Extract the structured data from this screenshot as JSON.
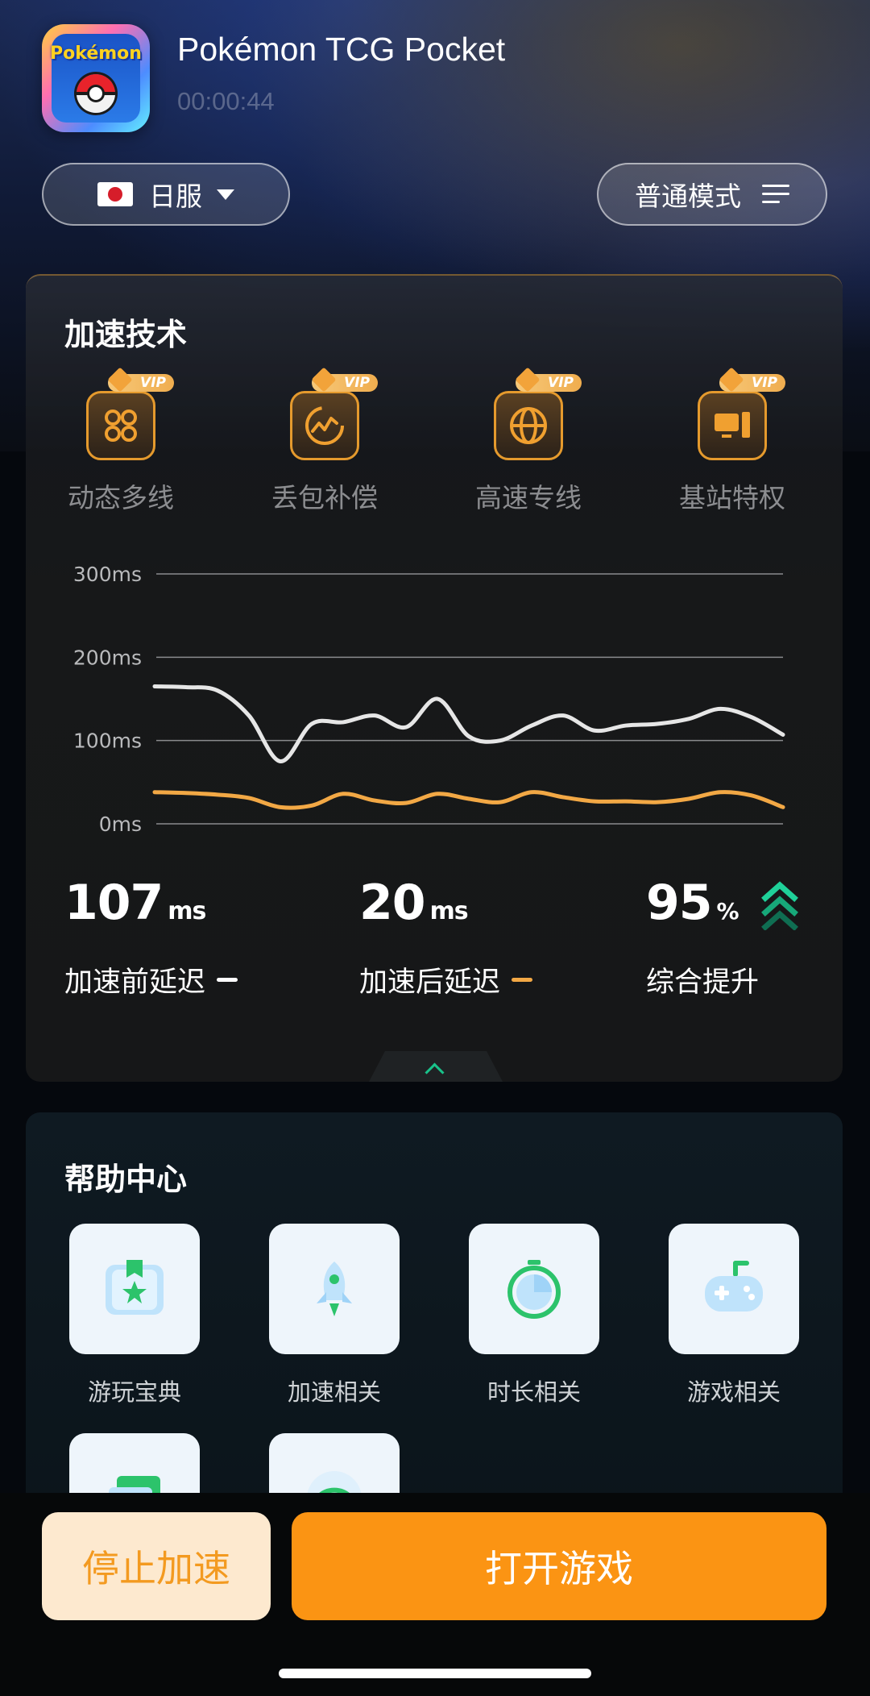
{
  "header": {
    "game_title": "Pokémon TCG Pocket",
    "timer": "00:00:44",
    "app_icon_text": "Pokémon",
    "region_label": "日服",
    "mode_label": "普通模式"
  },
  "accel": {
    "title": "加速技术",
    "vip_text": "VIP",
    "features": [
      {
        "label": "动态多线",
        "icon": "infinity-knot-icon"
      },
      {
        "label": "丢包补偿",
        "icon": "packet-wave-icon"
      },
      {
        "label": "高速专线",
        "icon": "globe-icon"
      },
      {
        "label": "基站特权",
        "icon": "desktop-computer-icon"
      }
    ],
    "stats": {
      "before_value": "107",
      "before_unit": "ms",
      "before_label": "加速前延迟",
      "after_value": "20",
      "after_unit": "ms",
      "after_label": "加速后延迟",
      "boost_value": "95",
      "boost_unit": "%",
      "boost_label": "综合提升"
    }
  },
  "chart_data": {
    "type": "line",
    "y_ticks": [
      "300ms",
      "200ms",
      "100ms",
      "0ms"
    ],
    "ylim": [
      0,
      300
    ],
    "x": [
      0,
      5,
      10,
      15,
      20,
      25,
      30,
      35,
      40,
      45,
      50,
      55,
      60,
      65,
      70,
      75,
      80,
      85,
      90,
      95,
      100
    ],
    "series": [
      {
        "name": "加速前延迟",
        "color": "#e6e6e6",
        "values": [
          165,
          164,
          160,
          130,
          75,
          120,
          122,
          130,
          116,
          150,
          105,
          100,
          118,
          130,
          112,
          118,
          120,
          126,
          138,
          128,
          107
        ]
      },
      {
        "name": "加速后延迟",
        "color": "#f2a845",
        "values": [
          38,
          37,
          35,
          31,
          20,
          22,
          36,
          28,
          25,
          36,
          30,
          26,
          38,
          32,
          27,
          27,
          26,
          30,
          38,
          34,
          20
        ]
      }
    ],
    "grid": true
  },
  "help": {
    "title": "帮助中心",
    "items": [
      {
        "label": "游玩宝典",
        "icon": "guide-book-icon"
      },
      {
        "label": "加速相关",
        "icon": "rocket-icon"
      },
      {
        "label": "时长相关",
        "icon": "stopwatch-icon"
      },
      {
        "label": "游戏相关",
        "icon": "gamepad-icon"
      },
      {
        "label": "",
        "icon": "card-icon"
      },
      {
        "label": "",
        "icon": "wifi-icon"
      }
    ]
  },
  "actions": {
    "stop_label": "停止加速",
    "open_label": "打开游戏"
  },
  "colors": {
    "accent_orange": "#fb9413",
    "stop_bg": "#fde9cf",
    "boost_green": "#19c28a"
  }
}
